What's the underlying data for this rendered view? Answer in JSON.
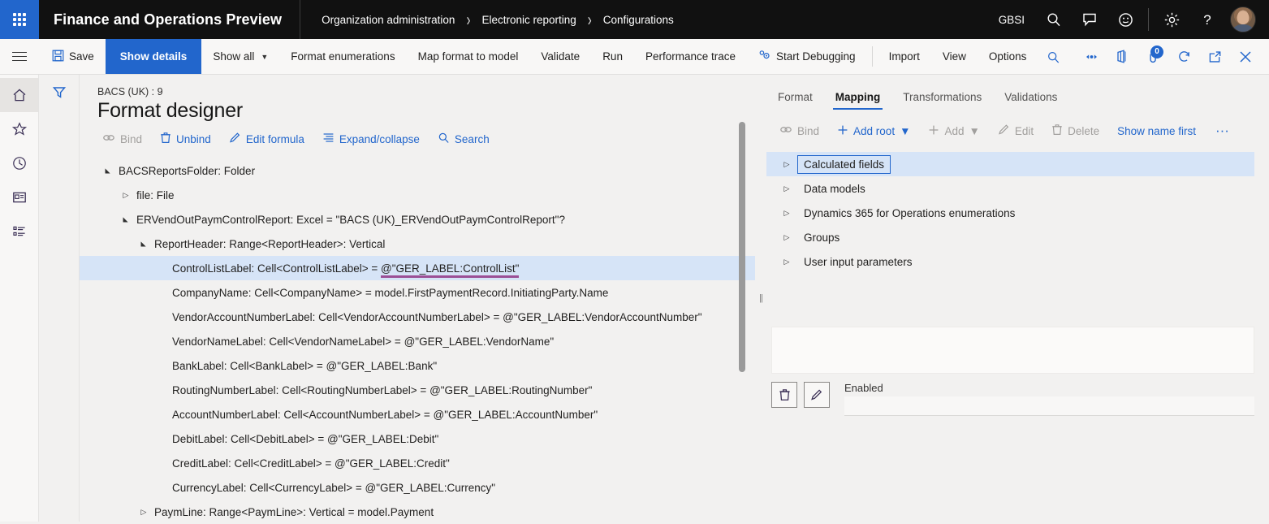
{
  "topnav": {
    "waffle_icon": "app-launcher-icon",
    "brand": "Finance and Operations Preview",
    "breadcrumb": [
      "Organization administration",
      "Electronic reporting",
      "Configurations"
    ],
    "company": "GBSI",
    "icons": [
      "search-icon",
      "message-icon",
      "feedback-smiley-icon",
      "gear-icon",
      "help-question-icon"
    ],
    "avatar": "user-avatar"
  },
  "actionpane": {
    "menu_icon": "hamburger-menu-icon",
    "items": [
      {
        "label": "Save",
        "icon": "save-disk-icon",
        "state": "normal"
      },
      {
        "label": "Show details",
        "icon": "",
        "state": "active"
      },
      {
        "label": "Show all",
        "icon": "",
        "state": "dropdown"
      },
      {
        "label": "Format enumerations",
        "icon": "",
        "state": "normal"
      },
      {
        "label": "Map format to model",
        "icon": "",
        "state": "normal"
      },
      {
        "label": "Validate",
        "icon": "",
        "state": "normal"
      },
      {
        "label": "Run",
        "icon": "",
        "state": "normal"
      },
      {
        "label": "Performance trace",
        "icon": "",
        "state": "normal"
      },
      {
        "label": "Start Debugging",
        "icon": "debug-gears-icon",
        "state": "normal"
      },
      {
        "label": "Import",
        "icon": "",
        "state": "normal"
      },
      {
        "label": "View",
        "icon": "",
        "state": "normal"
      },
      {
        "label": "Options",
        "icon": "",
        "state": "normal"
      }
    ],
    "search_icon": "search-icon",
    "right_icons": [
      {
        "name": "share-links-icon",
        "badge": ""
      },
      {
        "name": "office-apps-icon",
        "badge": ""
      },
      {
        "name": "attachments-icon",
        "badge": "0"
      },
      {
        "name": "refresh-icon",
        "badge": ""
      },
      {
        "name": "open-in-new-window-icon",
        "badge": ""
      },
      {
        "name": "close-icon",
        "badge": ""
      }
    ]
  },
  "leftrail": {
    "items": [
      {
        "name": "sidebar-item-home",
        "icon": "home-icon",
        "selected": true
      },
      {
        "name": "sidebar-item-favorites",
        "icon": "star-icon",
        "selected": false
      },
      {
        "name": "sidebar-item-recent",
        "icon": "clock-icon",
        "selected": false
      },
      {
        "name": "sidebar-item-workspaces",
        "icon": "workspace-card-icon",
        "selected": false
      },
      {
        "name": "sidebar-item-modules",
        "icon": "list-modules-icon",
        "selected": false
      }
    ]
  },
  "filterbar": {
    "icon": "filter-funnel-icon"
  },
  "format_designer": {
    "subtitle": "BACS (UK) : 9",
    "title": "Format designer",
    "toolbar": [
      {
        "label": "Bind",
        "icon": "bind-link-icon",
        "disabled": true
      },
      {
        "label": "Unbind",
        "icon": "trash-icon",
        "disabled": false
      },
      {
        "label": "Edit formula",
        "icon": "pencil-icon",
        "disabled": false
      },
      {
        "label": "Expand/collapse",
        "icon": "expand-collapse-list-icon",
        "disabled": false
      },
      {
        "label": "Search",
        "icon": "search-icon",
        "disabled": false
      }
    ],
    "tree": [
      {
        "indent": 0,
        "twisty": "open",
        "text": "BACSReportsFolder: Folder",
        "selected": false,
        "underline": ""
      },
      {
        "indent": 1,
        "twisty": "closed",
        "text": "file: File",
        "selected": false,
        "underline": ""
      },
      {
        "indent": 1,
        "twisty": "open",
        "text": "ERVendOutPaymControlReport: Excel = \"BACS (UK)_ERVendOutPaymControlReport\"?",
        "selected": false,
        "underline": ""
      },
      {
        "indent": 2,
        "twisty": "open",
        "text": "ReportHeader: Range<ReportHeader>: Vertical",
        "selected": false,
        "underline": ""
      },
      {
        "indent": 3,
        "twisty": "blank",
        "text": "ControlListLabel: Cell<ControlListLabel> = ",
        "selected": true,
        "underline": "@\"GER_LABEL:ControlList\""
      },
      {
        "indent": 3,
        "twisty": "blank",
        "text": "CompanyName: Cell<CompanyName> = model.FirstPaymentRecord.InitiatingParty.Name",
        "selected": false,
        "underline": ""
      },
      {
        "indent": 3,
        "twisty": "blank",
        "text": "VendorAccountNumberLabel: Cell<VendorAccountNumberLabel> = @\"GER_LABEL:VendorAccountNumber\"",
        "selected": false,
        "underline": ""
      },
      {
        "indent": 3,
        "twisty": "blank",
        "text": "VendorNameLabel: Cell<VendorNameLabel> = @\"GER_LABEL:VendorName\"",
        "selected": false,
        "underline": ""
      },
      {
        "indent": 3,
        "twisty": "blank",
        "text": "BankLabel: Cell<BankLabel> = @\"GER_LABEL:Bank\"",
        "selected": false,
        "underline": ""
      },
      {
        "indent": 3,
        "twisty": "blank",
        "text": "RoutingNumberLabel: Cell<RoutingNumberLabel> = @\"GER_LABEL:RoutingNumber\"",
        "selected": false,
        "underline": ""
      },
      {
        "indent": 3,
        "twisty": "blank",
        "text": "AccountNumberLabel: Cell<AccountNumberLabel> = @\"GER_LABEL:AccountNumber\"",
        "selected": false,
        "underline": ""
      },
      {
        "indent": 3,
        "twisty": "blank",
        "text": "DebitLabel: Cell<DebitLabel> = @\"GER_LABEL:Debit\"",
        "selected": false,
        "underline": ""
      },
      {
        "indent": 3,
        "twisty": "blank",
        "text": "CreditLabel: Cell<CreditLabel> = @\"GER_LABEL:Credit\"",
        "selected": false,
        "underline": ""
      },
      {
        "indent": 3,
        "twisty": "blank",
        "text": "CurrencyLabel: Cell<CurrencyLabel> = @\"GER_LABEL:Currency\"",
        "selected": false,
        "underline": ""
      },
      {
        "indent": 2,
        "twisty": "closed",
        "text": "PaymLine: Range<PaymLine>: Vertical = model.Payment",
        "selected": false,
        "underline": ""
      }
    ],
    "scrollbar": "vertical-scrollbar"
  },
  "splitter": {
    "name": "panel-splitter",
    "grip": "||"
  },
  "mapping": {
    "tabs": [
      {
        "label": "Format",
        "active": false
      },
      {
        "label": "Mapping",
        "active": true
      },
      {
        "label": "Transformations",
        "active": false
      },
      {
        "label": "Validations",
        "active": false
      }
    ],
    "toolbar": [
      {
        "label": "Bind",
        "icon": "bind-link-icon",
        "disabled": true,
        "dropdown": false
      },
      {
        "label": "Add root",
        "icon": "plus-icon",
        "disabled": false,
        "dropdown": true
      },
      {
        "label": "Add",
        "icon": "plus-icon",
        "disabled": true,
        "dropdown": true
      },
      {
        "label": "Edit",
        "icon": "pencil-icon",
        "disabled": true,
        "dropdown": false
      },
      {
        "label": "Delete",
        "icon": "trash-icon",
        "disabled": true,
        "dropdown": false
      },
      {
        "label": "Show name first",
        "icon": "",
        "disabled": false,
        "dropdown": false
      }
    ],
    "overflow_label": "···",
    "tree": [
      {
        "text": "Calculated fields",
        "selected": true
      },
      {
        "text": "Data models",
        "selected": false
      },
      {
        "text": "Dynamics 365 for Operations enumerations",
        "selected": false
      },
      {
        "text": "Groups",
        "selected": false
      },
      {
        "text": "User input parameters",
        "selected": false
      }
    ],
    "detail_panel": "",
    "delete_button_icon": "trash-icon",
    "edit_button_icon": "pencil-icon",
    "enabled_label": "Enabled",
    "enabled_value": ""
  },
  "colors": {
    "accent": "#2266cc",
    "topbar": "#111111",
    "selection": "#d6e4f7",
    "underline": "#9b4f96",
    "page_bg": "#f2f1f0"
  }
}
